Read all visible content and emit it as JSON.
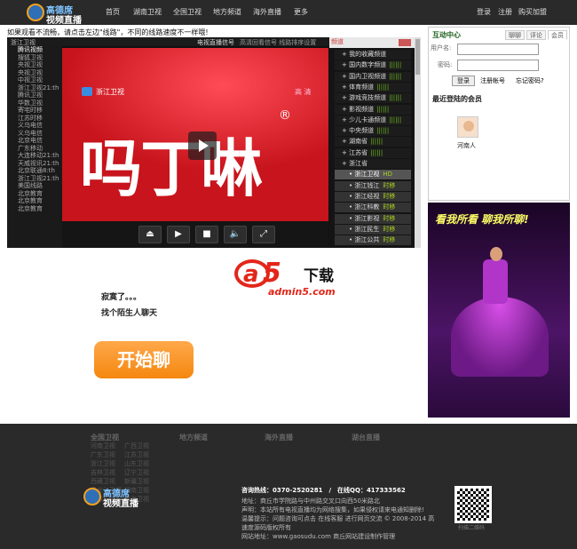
{
  "header": {
    "logo_line1": "高德席",
    "logo_line2": "视频直播",
    "nav": [
      "首页",
      "湖南卫视",
      "全国卫视",
      "地方频道",
      "海外直播",
      "更多"
    ],
    "auth": [
      "登录",
      "注册",
      "购买加盟"
    ]
  },
  "notice": "如果观看不流畅，请点击左边\"线路\"，不同的线路速度不一样哦!",
  "player": {
    "top_left": "浙江卫视",
    "top_mid": "电视直播信号",
    "top_right": "高清回看信号 线路排序设置",
    "left_channels": [
      "腾讯视频",
      "搜狐卫视",
      "央视卫视",
      "央视卫视",
      "中视卫视",
      "浙江卫视21:th",
      "腾讯卫视",
      "华数卫视",
      "寄宅时移",
      "江苏时移",
      "义乌电信",
      "义乌电信",
      "北京电信",
      "广东移动",
      "大连移动21:th",
      "天威视讯21:th",
      "北京联通8:th",
      "浙江卫视21:th",
      "美国线路",
      "北京教育",
      "北京教育",
      "北京教育"
    ],
    "video_station": "浙江卫视",
    "video_hd": "高 清",
    "video_brand": "吗丁啉",
    "video_reg": "®",
    "controls": [
      "⏏",
      "▶",
      "■",
      "🔈",
      "⤢"
    ],
    "right_header": "频道",
    "right_list": [
      {
        "label": "我的收藏频道",
        "type": "top",
        "bars": ""
      },
      {
        "label": "国内数字频道",
        "type": "top",
        "bars": "||||||"
      },
      {
        "label": "国内卫视频道",
        "type": "top",
        "bars": "||||||"
      },
      {
        "label": "体育频道",
        "type": "top",
        "bars": "||||||"
      },
      {
        "label": "游戏竞技频道",
        "type": "top",
        "bars": "||||||"
      },
      {
        "label": "影视频道",
        "type": "top",
        "bars": "||||||"
      },
      {
        "label": "少儿卡通频道",
        "type": "top",
        "bars": "||||||"
      },
      {
        "label": "中央频道",
        "type": "top",
        "bars": "||||||"
      },
      {
        "label": "湖南省",
        "type": "top",
        "bars": "||||||"
      },
      {
        "label": "江苏省",
        "type": "top",
        "bars": "||||||"
      },
      {
        "label": "浙江省",
        "type": "top",
        "bars": ""
      },
      {
        "label": "浙江卫视",
        "type": "act",
        "tag": "HD"
      },
      {
        "label": "浙江钱江",
        "type": "sub",
        "tag": "时移"
      },
      {
        "label": "浙江经视",
        "type": "sub",
        "tag": "时移"
      },
      {
        "label": "浙江科教",
        "type": "sub",
        "tag": "时移"
      },
      {
        "label": "浙江影视",
        "type": "sub",
        "tag": "时移"
      },
      {
        "label": "浙江民生",
        "type": "sub",
        "tag": "时移"
      },
      {
        "label": "浙江公共",
        "type": "sub",
        "tag": "时移"
      }
    ]
  },
  "sidebar": {
    "title": "互动中心",
    "tabs": [
      "聊聊",
      "评论",
      "会员"
    ],
    "username_label": "用户名:",
    "password_label": "密码:",
    "login_btn": "登录",
    "register_link": "注册帐号",
    "forgot_link": "忘记密码?",
    "recent_title": "最近登陆的会员",
    "recent_user": "河南人"
  },
  "ad": {
    "slogan": "看我所看 聊我所聊!"
  },
  "chat": {
    "logo_a": "a",
    "logo_5": "5",
    "logo_dl": "下载",
    "logo_domain": "admin5.com",
    "line1": "寂寞了。。。",
    "line2": "找个陌生人聊天",
    "start_btn": "开始聊"
  },
  "footer": {
    "col_headers": [
      "全国卫视",
      "地方频道",
      "海外直播",
      "湖台直播"
    ],
    "col1_links": [
      [
        "河南卫视",
        "广西卫视"
      ],
      [
        "广东卫视",
        "江苏卫视"
      ],
      [
        "浙江卫视",
        "山东卫视"
      ],
      [
        "吉林卫视",
        "辽宁卫视"
      ],
      [
        "西藏卫视",
        "新疆卫视"
      ],
      [
        "黑龙江卫视",
        "湖南卫视"
      ],
      [
        "安徽卫视",
        "青海卫视"
      ]
    ],
    "logo_line1": "高德席",
    "logo_line2": "视频直播",
    "hotline": "咨询热线：0370-2520281　/　在线QQ：417333562",
    "address": "地址：商丘市学院路与中州路交叉口向西50米路北",
    "statement": "声明：本站所有电视直播均为网络搜集，如果侵权请来电通知删除!",
    "tip": "温馨提示：问题咨询可点击 在线客服 进行网页交流 © 2008-2014 高",
    "tip2": "速度源码版权所有",
    "site": "网站地址：www.gaosudu.com  商丘网站建设制作管理",
    "qr_caption": "扫描二维码"
  }
}
